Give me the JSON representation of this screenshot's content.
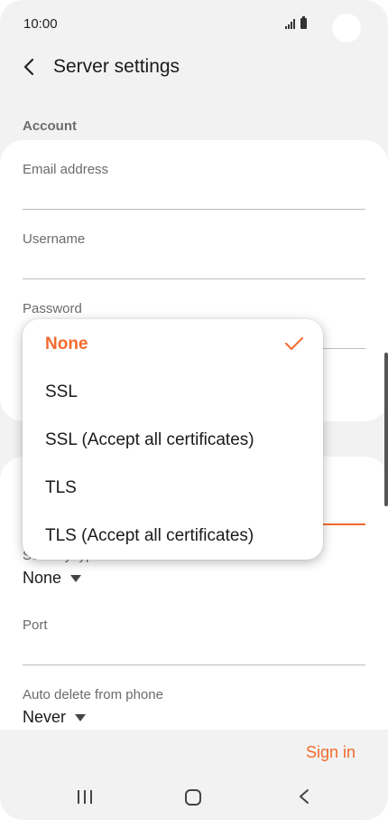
{
  "status_bar": {
    "time": "10:00"
  },
  "header": {
    "title": "Server settings"
  },
  "account": {
    "section_label": "Account",
    "email_label": "Email address",
    "email_value": "",
    "username_label": "Username",
    "username_value": "",
    "password_label": "Password",
    "password_value": ""
  },
  "incoming": {
    "security_type_label": "Security type",
    "security_type_value": "None",
    "port_label": "Port",
    "port_value": "",
    "auto_delete_label": "Auto delete from phone",
    "auto_delete_value": "Never"
  },
  "security_dropdown": {
    "options": [
      {
        "label": "None",
        "selected": true
      },
      {
        "label": "SSL",
        "selected": false
      },
      {
        "label": "SSL (Accept all certificates)",
        "selected": false
      },
      {
        "label": "TLS",
        "selected": false
      },
      {
        "label": "TLS (Accept all certificates)",
        "selected": false
      }
    ]
  },
  "footer": {
    "sign_in_label": "Sign in"
  },
  "colors": {
    "accent": "#f26a2e",
    "background": "#f2f2f2",
    "card": "#ffffff"
  },
  "icons": [
    "signal-icon",
    "battery-icon",
    "back-arrow-icon",
    "caret-down-icon",
    "check-icon",
    "recents-icon",
    "home-icon",
    "nav-back-icon"
  ]
}
